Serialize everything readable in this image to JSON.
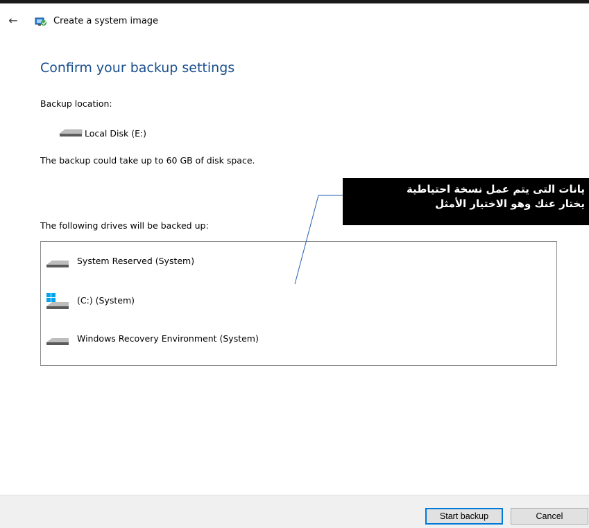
{
  "window": {
    "title": "Create a system image"
  },
  "page": {
    "heading": "Confirm your backup settings",
    "backup_location_label": "Backup location:",
    "backup_location_value": "Local Disk (E:)",
    "space_notice": "The backup could take up to 60 GB of disk space.",
    "drives_label": "The following drives will be backed up:",
    "drives": [
      {
        "label": "System Reserved (System)",
        "icon": "disk-icon"
      },
      {
        "label": "(C:) (System)",
        "icon": "windows-disk-icon"
      },
      {
        "label": "Windows Recovery Environment (System)",
        "icon": "disk-icon"
      }
    ]
  },
  "annotation": {
    "line1": "يانات التى يتم عمل نسخة احتياطية",
    "line2": "يختار عنك وهو الاختيار الأمثل"
  },
  "footer": {
    "start_label": "Start backup",
    "cancel_label": "Cancel"
  },
  "colors": {
    "heading": "#1a4f8f",
    "default_button_border": "#0078d7",
    "callout_bg": "#000000"
  }
}
